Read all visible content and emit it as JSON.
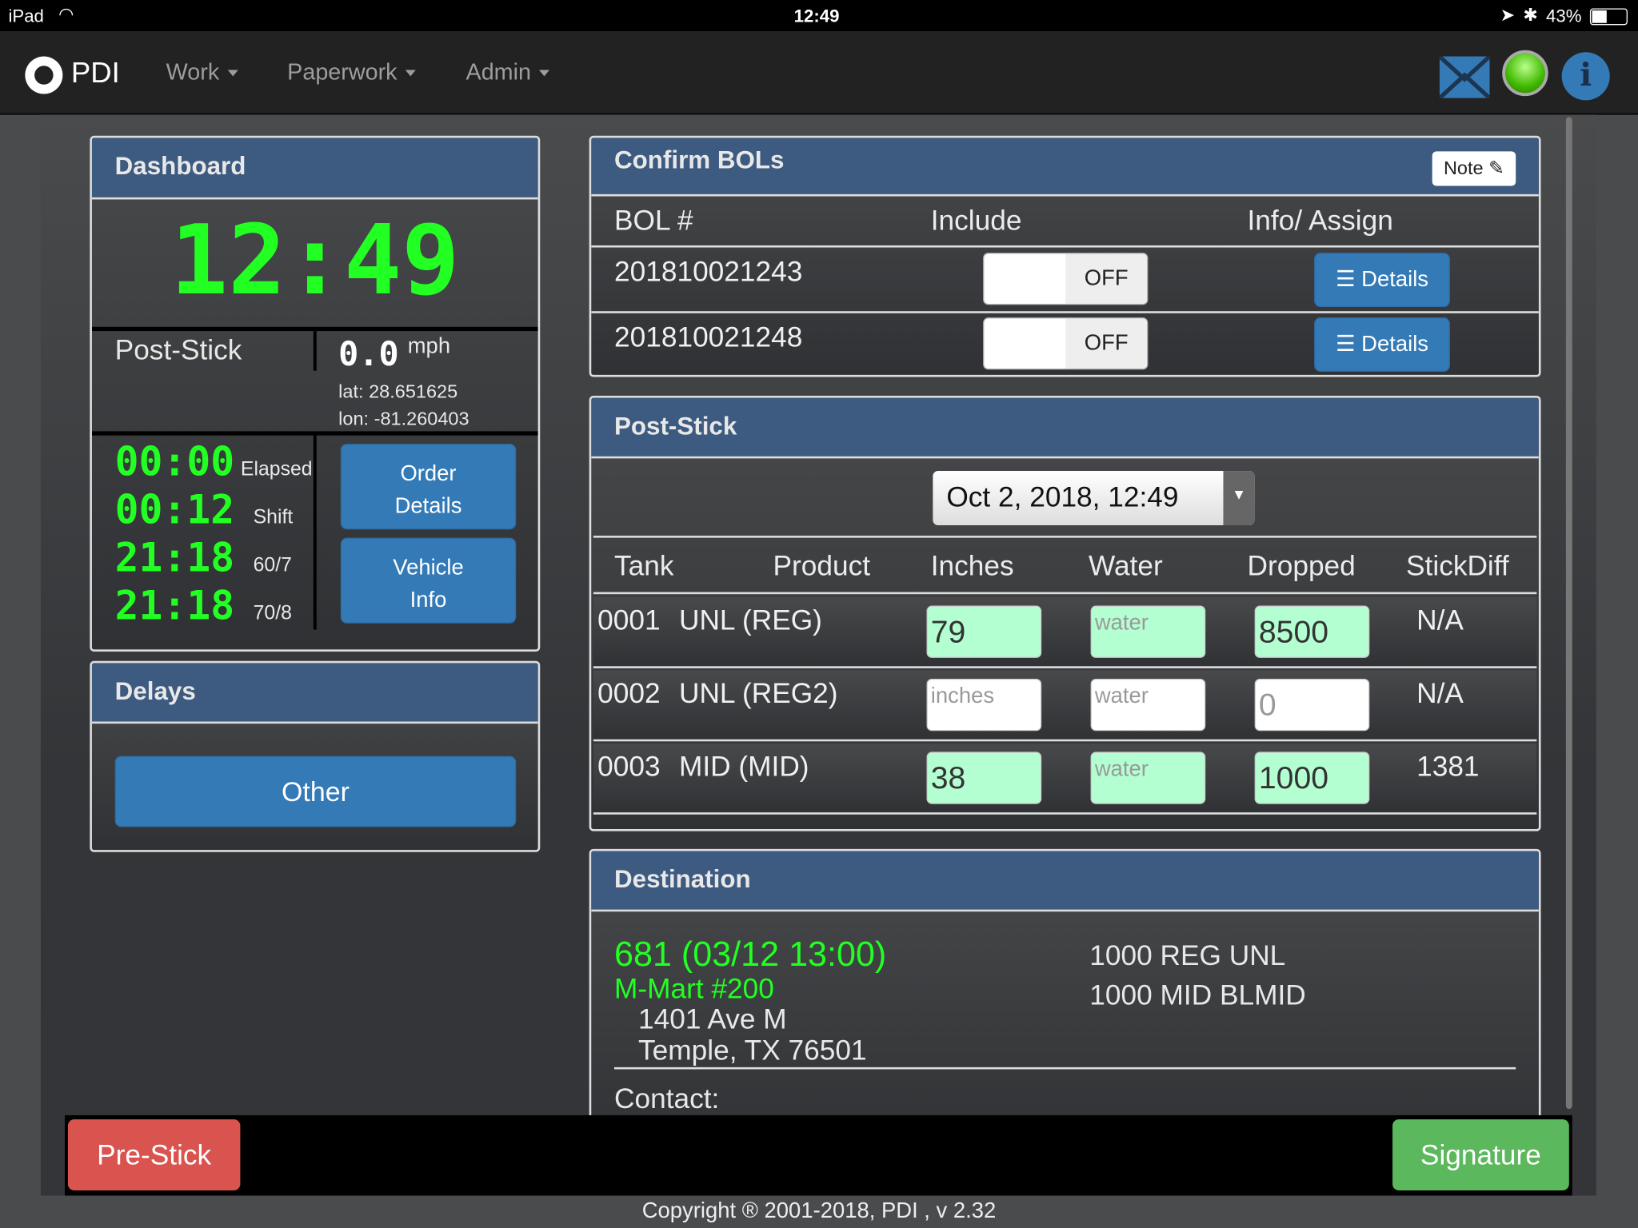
{
  "status_bar": {
    "device": "iPad",
    "time": "12:49",
    "battery": "43%"
  },
  "nav": {
    "brand": "PDI",
    "menus": [
      {
        "label": "Work"
      },
      {
        "label": "Paperwork"
      },
      {
        "label": "Admin"
      }
    ],
    "icons": [
      "mail-icon",
      "status-light-icon",
      "info-icon"
    ]
  },
  "dashboard": {
    "title": "Dashboard",
    "clock": "12:49",
    "mode": "Post-Stick",
    "speed": "0.0",
    "speed_unit": "mph",
    "lat": "lat: 28.651625",
    "lon": "lon: -81.260403",
    "timers": [
      {
        "value": "00:00",
        "label": "Elapsed"
      },
      {
        "value": "00:12",
        "label": "Shift"
      },
      {
        "value": "21:18",
        "label": "60/7"
      },
      {
        "value": "21:18",
        "label": "70/8"
      }
    ],
    "order_details": [
      "Order",
      "Details"
    ],
    "vehicle_info": [
      "Vehicle",
      "Info"
    ]
  },
  "delays": {
    "title": "Delays",
    "other": "Other"
  },
  "bols": {
    "title": "Confirm BOLs",
    "note": "Note",
    "headers": [
      "BOL #",
      "Include",
      "Info/ Assign"
    ],
    "rows": [
      {
        "bol": "201810021243",
        "include": "OFF",
        "details": "Details"
      },
      {
        "bol": "201810021248",
        "include": "OFF",
        "details": "Details"
      }
    ]
  },
  "poststick": {
    "title": "Post-Stick",
    "datetime": "Oct 2, 2018, 12:49",
    "headers": [
      "Tank",
      "Product",
      "Inches",
      "Water",
      "Dropped",
      "StickDiff"
    ],
    "rows": [
      {
        "tank": "0001",
        "product": "UNL (REG)",
        "inches": "79",
        "inches_ph": "inches",
        "water": "",
        "water_ph": "water",
        "dropped": "8500",
        "diff": "N/A",
        "filled": true
      },
      {
        "tank": "0002",
        "product": "UNL (REG2)",
        "inches": "",
        "inches_ph": "inches",
        "water": "",
        "water_ph": "water",
        "dropped": "0",
        "diff": "N/A",
        "filled": false
      },
      {
        "tank": "0003",
        "product": "MID (MID)",
        "inches": "38",
        "inches_ph": "inches",
        "water": "",
        "water_ph": "water",
        "dropped": "1000",
        "diff": "1381",
        "filled": true
      }
    ]
  },
  "destination": {
    "title": "Destination",
    "order": "681 (03/12 13:00)",
    "site": "M-Mart #200",
    "address1": "1401 Ave M",
    "address2": "Temple, TX 76501",
    "products": [
      "1000 REG UNL",
      "1000 MID BLMID"
    ],
    "contact": "Contact:"
  },
  "footer": {
    "prestick": "Pre-Stick",
    "signature": "Signature",
    "copyright": "Copyright ® 2001-2018, PDI , v 2.32"
  },
  "colors": {
    "header": "#3d5a80",
    "primary": "#337ab7",
    "danger": "#d9534f",
    "success": "#5cb85c",
    "digital": "#22ff22",
    "input_filled": "#b3ffd1"
  }
}
